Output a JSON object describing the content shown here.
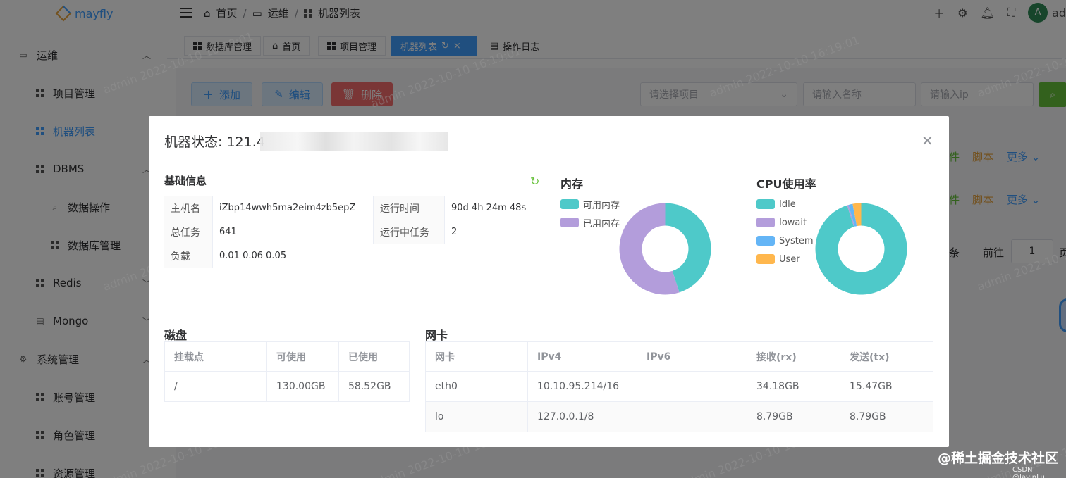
{
  "app": {
    "logo_text": "mayfly"
  },
  "sidebar": {
    "items": [
      {
        "label": "运维",
        "icon": "monitor-icon",
        "chevron": "chevron-up-icon"
      },
      {
        "label": "项目管理",
        "icon": "grid-icon"
      },
      {
        "label": "机器列表",
        "icon": "grid-icon",
        "active": true
      },
      {
        "label": "DBMS",
        "icon": "grid-icon",
        "chevron": "chevron-up-icon"
      },
      {
        "label": "数据操作",
        "icon": "search-icon"
      },
      {
        "label": "数据库管理",
        "icon": "grid-icon"
      },
      {
        "label": "Redis",
        "icon": "grid-icon",
        "chevron": "chevron-down-icon"
      },
      {
        "label": "Mongo",
        "icon": "document-icon",
        "chevron": "chevron-down-icon"
      },
      {
        "label": "系统管理",
        "icon": "gear-icon",
        "chevron": "chevron-up-icon"
      },
      {
        "label": "账号管理",
        "icon": "grid-icon"
      },
      {
        "label": "角色管理",
        "icon": "grid-icon"
      },
      {
        "label": "资源管理",
        "icon": "grid-icon"
      }
    ]
  },
  "header": {
    "breadcrumb": [
      "首页",
      "运维",
      "机器列表"
    ],
    "user_initial": "A",
    "user_name": "ad"
  },
  "tabs": [
    {
      "label": "数据库管理",
      "icon": "grid-icon"
    },
    {
      "label": "首页",
      "icon": "home-icon"
    },
    {
      "label": "项目管理",
      "icon": "grid-icon"
    },
    {
      "label": "机器列表",
      "icon": "",
      "active": true
    },
    {
      "label": "操作日志",
      "icon": "document-icon"
    }
  ],
  "toolbar": {
    "add_label": "添加",
    "edit_label": "编辑",
    "delete_label": "删除",
    "project_placeholder": "请选择项目",
    "name_placeholder": "请输入名称",
    "ip_placeholder": "请输入ip"
  },
  "table_actions": {
    "file": "件",
    "script": "脚本",
    "more": "更多"
  },
  "pagination": {
    "unit": "条",
    "goto": "前往",
    "page": "1",
    "page_suffix": "页"
  },
  "watermark": "admin 2022-10-10 16:19:01",
  "dialog": {
    "title": "机器状态: 121.4",
    "basic_title": "基础信息",
    "basic_info": {
      "hostname_label": "主机名",
      "hostname": "iZbp14wwh5ma2eim4zb5epZ",
      "uptime_label": "运行时间",
      "uptime": "90d 4h 24m 48s",
      "tasks_label": "总任务",
      "tasks": "641",
      "running_label": "运行中任务",
      "running": "2",
      "load_label": "负载",
      "load": "0.01 0.06 0.05"
    },
    "memory_title": "内存",
    "cpu_title": "CPU使用率",
    "disk_title": "磁盘",
    "disk_table": {
      "headers": [
        "挂载点",
        "可使用",
        "已使用"
      ],
      "rows": [
        [
          "/",
          "130.00GB",
          "58.52GB"
        ]
      ]
    },
    "nic_title": "网卡",
    "nic_table": {
      "headers": [
        "网卡",
        "IPv4",
        "IPv6",
        "接收(rx)",
        "发送(tx)"
      ],
      "rows": [
        [
          "eth0",
          "10.10.95.214/16",
          "",
          "34.18GB",
          "15.47GB"
        ],
        [
          "lo",
          "127.0.0.1/8",
          "",
          "8.79GB",
          "8.79GB"
        ]
      ]
    }
  },
  "chart_data": [
    {
      "type": "pie",
      "title": "内存",
      "labels": [
        "可用内存",
        "已用内存"
      ],
      "values": [
        45,
        55
      ],
      "colors": [
        "#4ec9c9",
        "#b39ddb"
      ]
    },
    {
      "type": "pie",
      "title": "CPU使用率",
      "labels": [
        "Idle",
        "Iowait",
        "System",
        "User"
      ],
      "values": [
        95,
        0.5,
        1.5,
        3
      ],
      "colors": [
        "#4ec9c9",
        "#b39ddb",
        "#64b5f6",
        "#ffb74d"
      ]
    }
  ],
  "footer": {
    "site": "@稀土掘金技术社区",
    "csdn": "CSDN @JavinLu"
  }
}
